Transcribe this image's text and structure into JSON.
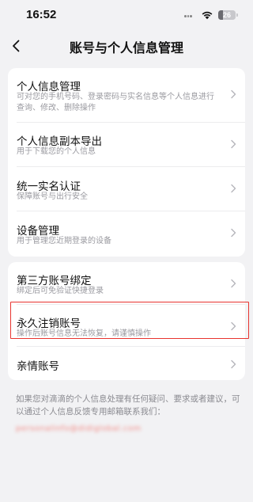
{
  "status_bar": {
    "time": "16:52",
    "battery_level": "26",
    "battery_fraction": 0.26
  },
  "nav": {
    "back_icon": "chevron-left-icon",
    "title": "账号与个人信息管理"
  },
  "group1": {
    "items": [
      {
        "title": "个人信息管理",
        "subtitle": "可对您的手机号码、登录密码与实名信息等个人信息进行查询、修改、删除操作"
      },
      {
        "title": "个人信息副本导出",
        "subtitle": "用于下载您的个人信息"
      },
      {
        "title": "统一实名认证",
        "subtitle": "保障账号与出行安全"
      },
      {
        "title": "设备管理",
        "subtitle": "用于管理您近期登录的设备"
      }
    ]
  },
  "group2": {
    "items": [
      {
        "title": "第三方账号绑定",
        "subtitle": "绑定后可免验证快捷登录"
      },
      {
        "title": "永久注销账号",
        "subtitle": "操作后账号信息无法恢复，请谨慎操作"
      },
      {
        "title": "亲情账号",
        "subtitle": ""
      }
    ]
  },
  "footer": {
    "note": "如果您对滴滴的个人信息处理有任何疑问、要求或者建议，可以通过个人信息反馈专用邮箱联系我们：",
    "email": "personalinfo@didiglobal.com"
  },
  "colors": {
    "background": "#f2f2f4",
    "card": "#ffffff",
    "highlight": "#e8342f",
    "subtitle": "#9a9aa0"
  }
}
